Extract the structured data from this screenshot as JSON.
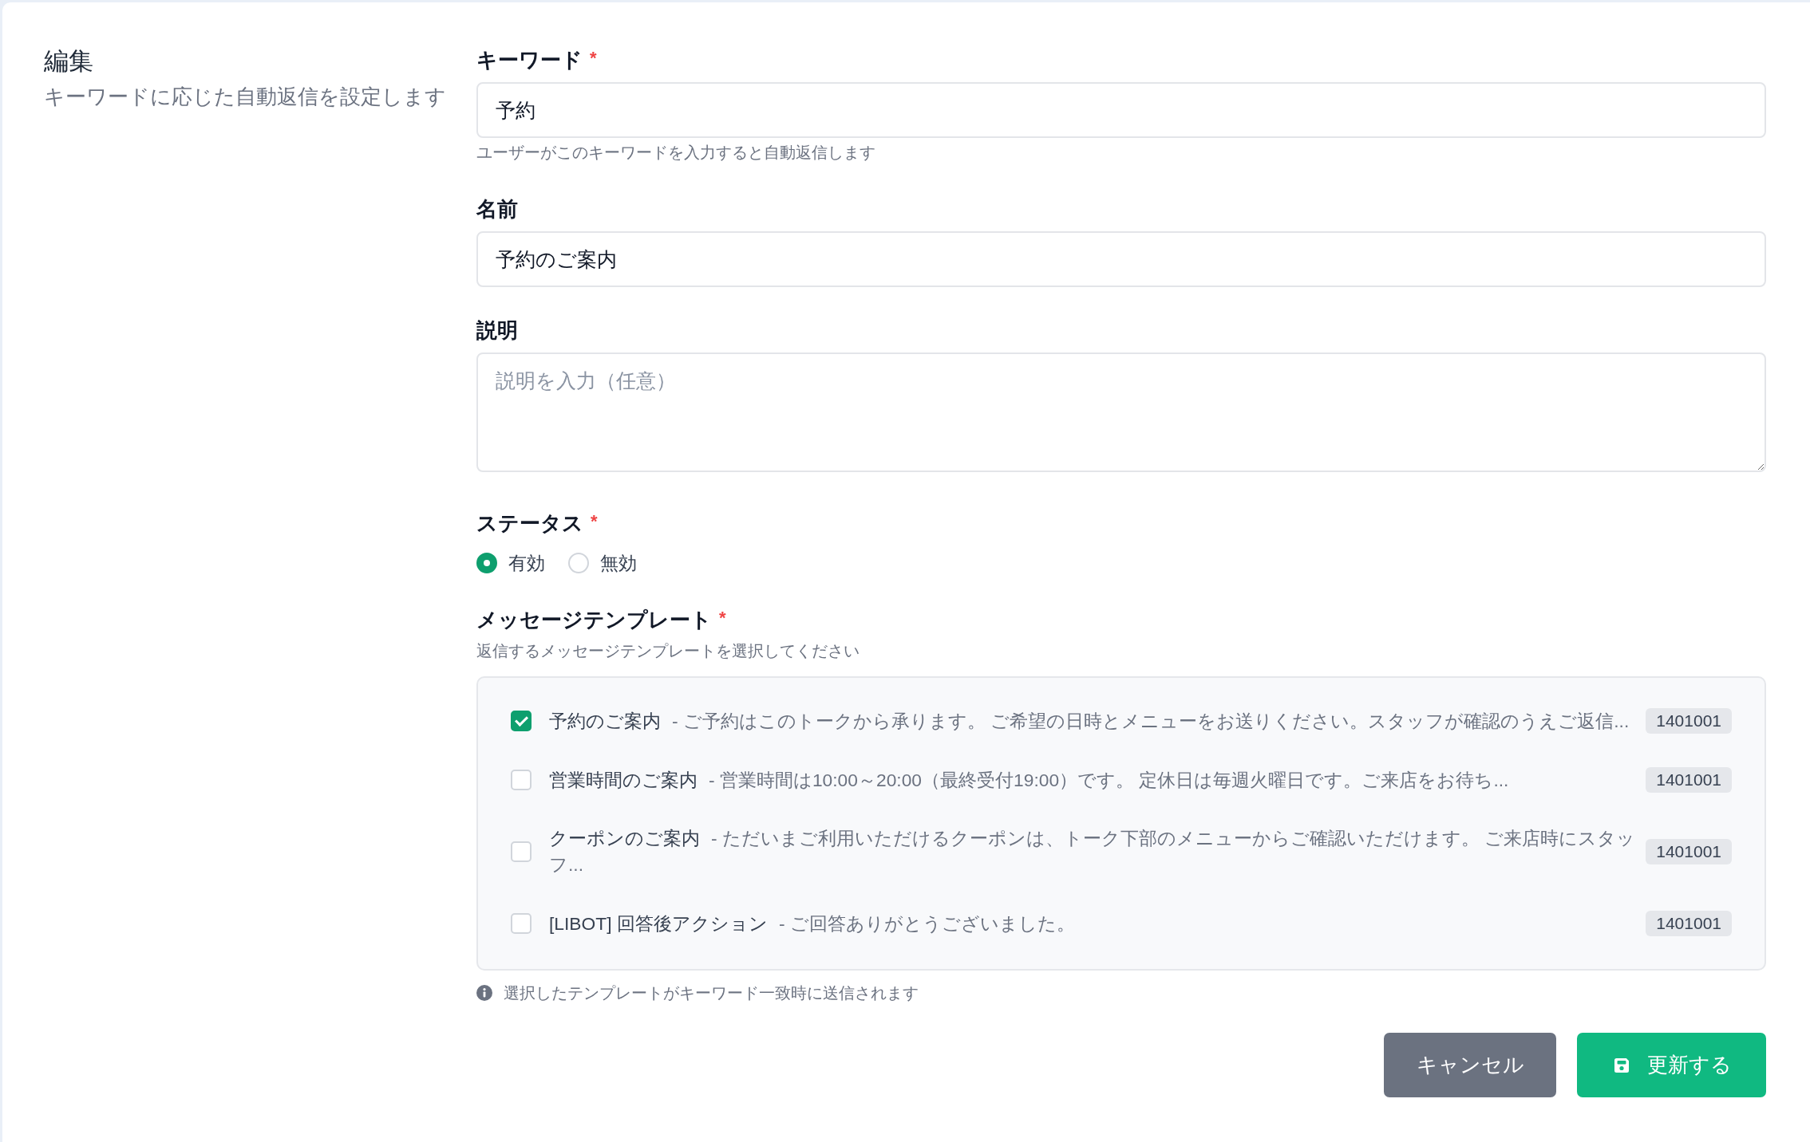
{
  "header": {
    "title": "編集",
    "subtitle": "キーワードに応じた自動返信を設定します"
  },
  "form": {
    "keyword": {
      "label": "キーワード",
      "required_mark": "*",
      "value": "予約",
      "hint": "ユーザーがこのキーワードを入力すると自動返信します"
    },
    "name": {
      "label": "名前",
      "value": "予約のご案内"
    },
    "description": {
      "label": "説明",
      "placeholder": "説明を入力（任意）"
    },
    "status": {
      "label": "ステータス",
      "required_mark": "*",
      "options": [
        {
          "label": "有効",
          "selected": true
        },
        {
          "label": "無効",
          "selected": false
        }
      ]
    },
    "templates": {
      "label": "メッセージテンプレート",
      "required_mark": "*",
      "hint": "返信するメッセージテンプレートを選択してください",
      "items": [
        {
          "name": "予約のご案内",
          "description": "- ご予約はこのトークから承ります。 ご希望の日時とメニューをお送りください。スタッフが確認のうえご返信...",
          "code": "1401001",
          "checked": true
        },
        {
          "name": "営業時間のご案内",
          "description": "- 営業時間は10:00～20:00（最終受付19:00）です。 定休日は毎週火曜日です。ご来店をお待ち...",
          "code": "1401001",
          "checked": false
        },
        {
          "name": "クーポンのご案内",
          "description": "- ただいまご利用いただけるクーポンは、トーク下部のメニューからご確認いただけます。 ご来店時にスタッフ...",
          "code": "1401001",
          "checked": false
        },
        {
          "name": "[LIBOT] 回答後アクション",
          "description": "- ご回答ありがとうございました。",
          "code": "1401001",
          "checked": false
        }
      ],
      "note": "選択したテンプレートがキーワード一致時に送信されます"
    }
  },
  "buttons": [
    {
      "kind": "cancel",
      "label": "キャンセル"
    },
    {
      "kind": "submit",
      "label": "更新する"
    }
  ]
}
